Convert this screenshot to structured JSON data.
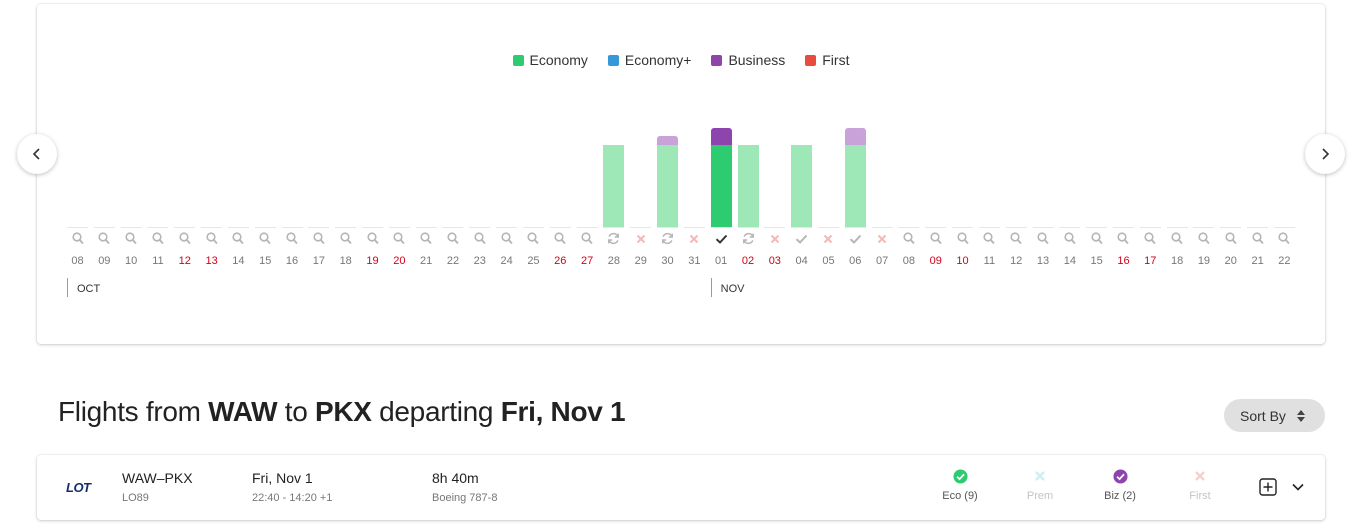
{
  "legend": [
    {
      "label": "Economy",
      "color": "#2ecc71"
    },
    {
      "label": "Economy+",
      "color": "#3498db"
    },
    {
      "label": "Business",
      "color": "#8e44ad"
    },
    {
      "label": "First",
      "color": "#e74c3c"
    }
  ],
  "calendar": {
    "months": [
      {
        "label": "OCT",
        "start_index": 0
      },
      {
        "label": "NOV",
        "start_index": 24
      }
    ],
    "days": [
      {
        "num": "08",
        "weekend": false,
        "status": "search",
        "economy": 0,
        "business": 0
      },
      {
        "num": "09",
        "weekend": false,
        "status": "search",
        "economy": 0,
        "business": 0
      },
      {
        "num": "10",
        "weekend": false,
        "status": "search",
        "economy": 0,
        "business": 0
      },
      {
        "num": "11",
        "weekend": false,
        "status": "search",
        "economy": 0,
        "business": 0
      },
      {
        "num": "12",
        "weekend": true,
        "status": "search",
        "economy": 0,
        "business": 0
      },
      {
        "num": "13",
        "weekend": true,
        "status": "search",
        "economy": 0,
        "business": 0
      },
      {
        "num": "14",
        "weekend": false,
        "status": "search",
        "economy": 0,
        "business": 0
      },
      {
        "num": "15",
        "weekend": false,
        "status": "search",
        "economy": 0,
        "business": 0
      },
      {
        "num": "16",
        "weekend": false,
        "status": "search",
        "economy": 0,
        "business": 0
      },
      {
        "num": "17",
        "weekend": false,
        "status": "search",
        "economy": 0,
        "business": 0
      },
      {
        "num": "18",
        "weekend": false,
        "status": "search",
        "economy": 0,
        "business": 0
      },
      {
        "num": "19",
        "weekend": true,
        "status": "search",
        "economy": 0,
        "business": 0
      },
      {
        "num": "20",
        "weekend": true,
        "status": "search",
        "economy": 0,
        "business": 0
      },
      {
        "num": "21",
        "weekend": false,
        "status": "search",
        "economy": 0,
        "business": 0
      },
      {
        "num": "22",
        "weekend": false,
        "status": "search",
        "economy": 0,
        "business": 0
      },
      {
        "num": "23",
        "weekend": false,
        "status": "search",
        "economy": 0,
        "business": 0
      },
      {
        "num": "24",
        "weekend": false,
        "status": "search",
        "economy": 0,
        "business": 0
      },
      {
        "num": "25",
        "weekend": false,
        "status": "search",
        "economy": 0,
        "business": 0
      },
      {
        "num": "26",
        "weekend": true,
        "status": "search",
        "economy": 0,
        "business": 0
      },
      {
        "num": "27",
        "weekend": true,
        "status": "search",
        "economy": 0,
        "business": 0
      },
      {
        "num": "28",
        "weekend": false,
        "status": "refresh",
        "economy": 0.62,
        "business": 0
      },
      {
        "num": "29",
        "weekend": false,
        "status": "none",
        "economy": 0,
        "business": 0
      },
      {
        "num": "30",
        "weekend": false,
        "status": "refresh",
        "economy": 0.62,
        "business": 0.07
      },
      {
        "num": "31",
        "weekend": false,
        "status": "none",
        "economy": 0,
        "business": 0
      },
      {
        "num": "01",
        "weekend": false,
        "status": "selected",
        "economy": 0.62,
        "business": 0.13,
        "selected": true
      },
      {
        "num": "02",
        "weekend": true,
        "status": "refresh",
        "economy": 0.62,
        "business": 0
      },
      {
        "num": "03",
        "weekend": true,
        "status": "none",
        "economy": 0,
        "business": 0
      },
      {
        "num": "04",
        "weekend": false,
        "status": "check",
        "economy": 0.62,
        "business": 0
      },
      {
        "num": "05",
        "weekend": false,
        "status": "none",
        "economy": 0,
        "business": 0
      },
      {
        "num": "06",
        "weekend": false,
        "status": "check",
        "economy": 0.62,
        "business": 0.13
      },
      {
        "num": "07",
        "weekend": false,
        "status": "none",
        "economy": 0,
        "business": 0
      },
      {
        "num": "08",
        "weekend": false,
        "status": "search",
        "economy": 0,
        "business": 0
      },
      {
        "num": "09",
        "weekend": true,
        "status": "search",
        "economy": 0,
        "business": 0
      },
      {
        "num": "10",
        "weekend": true,
        "status": "search",
        "economy": 0,
        "business": 0
      },
      {
        "num": "11",
        "weekend": false,
        "status": "search",
        "economy": 0,
        "business": 0
      },
      {
        "num": "12",
        "weekend": false,
        "status": "search",
        "economy": 0,
        "business": 0
      },
      {
        "num": "13",
        "weekend": false,
        "status": "search",
        "economy": 0,
        "business": 0
      },
      {
        "num": "14",
        "weekend": false,
        "status": "search",
        "economy": 0,
        "business": 0
      },
      {
        "num": "15",
        "weekend": false,
        "status": "search",
        "economy": 0,
        "business": 0
      },
      {
        "num": "16",
        "weekend": true,
        "status": "search",
        "economy": 0,
        "business": 0
      },
      {
        "num": "17",
        "weekend": true,
        "status": "search",
        "economy": 0,
        "business": 0
      },
      {
        "num": "18",
        "weekend": false,
        "status": "search",
        "economy": 0,
        "business": 0
      },
      {
        "num": "19",
        "weekend": false,
        "status": "search",
        "economy": 0,
        "business": 0
      },
      {
        "num": "20",
        "weekend": false,
        "status": "search",
        "economy": 0,
        "business": 0
      },
      {
        "num": "21",
        "weekend": false,
        "status": "search",
        "economy": 0,
        "business": 0
      },
      {
        "num": "22",
        "weekend": false,
        "status": "search",
        "economy": 0,
        "business": 0
      }
    ]
  },
  "results": {
    "title_prefix": "Flights from",
    "origin": "WAW",
    "to": "to",
    "destination": "PKX",
    "departing": "departing",
    "date": "Fri, Nov 1"
  },
  "sort": {
    "label": "Sort By"
  },
  "flight": {
    "airline_logo": "LOT",
    "route": "WAW–PKX",
    "flight_number": "LO89",
    "date": "Fri, Nov 1",
    "times": "22:40 - 14:20 +1",
    "duration": "8h 40m",
    "aircraft": "Boeing 787-8",
    "cabins": [
      {
        "label": "Eco (9)",
        "available": true,
        "color": "#2ecc71",
        "text_color": "#555"
      },
      {
        "label": "Prem",
        "available": false,
        "color": "#cfeef0",
        "text_color": "#c4c4c4"
      },
      {
        "label": "Biz (2)",
        "available": true,
        "color": "#8e44ad",
        "text_color": "#555"
      },
      {
        "label": "First",
        "available": false,
        "color": "#f6d0d0",
        "text_color": "#c4c4c4"
      }
    ]
  }
}
